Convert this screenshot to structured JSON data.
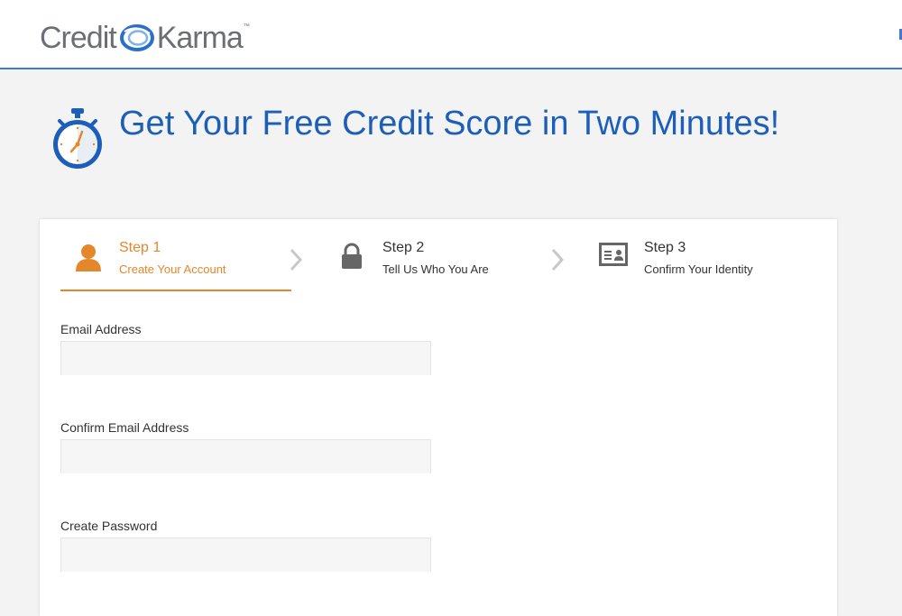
{
  "header": {
    "logo_text_left": "Credit",
    "logo_text_right": "Karma",
    "logo_tm": "™"
  },
  "hero": {
    "title": "Get Your Free Credit Score in Two Minutes!",
    "icon": "stopwatch-icon"
  },
  "steps": [
    {
      "number": "Step 1",
      "label": "Create Your Account",
      "icon": "person-icon",
      "active": true
    },
    {
      "number": "Step 2",
      "label": "Tell Us Who You Are",
      "icon": "lock-icon",
      "active": false
    },
    {
      "number": "Step 3",
      "label": "Confirm Your Identity",
      "icon": "id-card-icon",
      "active": false
    }
  ],
  "form": {
    "email": {
      "label": "Email Address",
      "value": "",
      "placeholder": ""
    },
    "confirm_email": {
      "label": "Confirm Email Address",
      "value": "",
      "placeholder": ""
    },
    "password": {
      "label": "Create Password",
      "value": "",
      "placeholder": ""
    }
  },
  "colors": {
    "brand_blue": "#1c5fb8",
    "active_orange": "#e4872a",
    "header_border": "#3a7bd5",
    "page_bg": "#f3f3f3"
  }
}
